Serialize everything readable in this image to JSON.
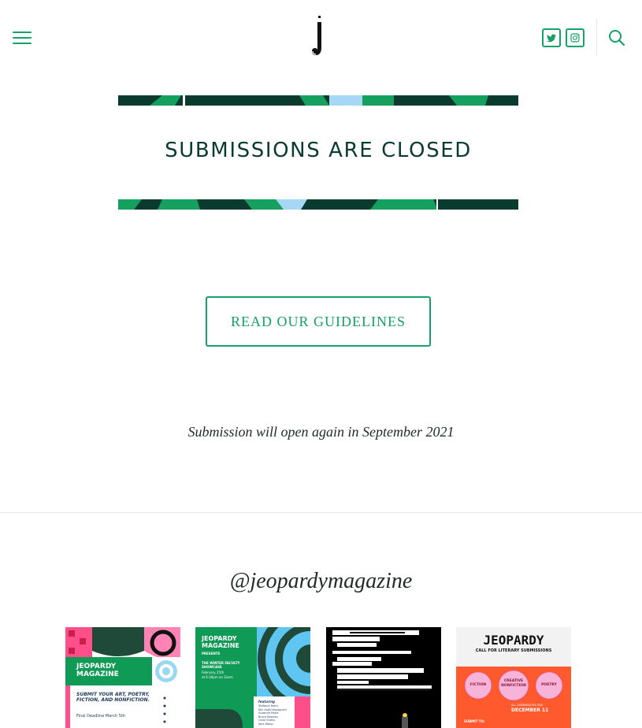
{
  "header": {
    "menu_icon": "hamburger-icon",
    "logo_icon": "jeopardy-j-logo",
    "social": [
      {
        "name": "twitter-icon"
      },
      {
        "name": "instagram-icon"
      }
    ],
    "search_icon": "search-icon"
  },
  "banner": {
    "title": "SUBMISSIONS ARE CLOSED",
    "colors": {
      "dark": "#0b3a2e",
      "green": "#15a05f",
      "blue": "#a6d8f5",
      "text": "#0b3a34"
    }
  },
  "guidelines_button": {
    "label": "READ OUR GUIDELINES"
  },
  "notice": "Submission will open again in September 2021",
  "instagram": {
    "handle": "@jeopardymagazine",
    "posts": [
      {
        "title": "JEOPARDY MAGAZINE",
        "body": "SUBMIT YOUR ART, POETRY, FICTION, AND NONFICTION.",
        "footer": "Final Deadline March 5th"
      },
      {
        "title": "JEOPARDY MAGAZINE",
        "subtitle": "PRESENTS",
        "event": "THE WINTER FACULTY SHOWCASE",
        "date": "February 25th",
        "time": "at 6:30pm on Zoom",
        "featuring_label": "featuring",
        "featuring": [
          "Stefania Heim",
          "Kiki Arabi Kavoguchi",
          "Suzanne Paola",
          "Bruce Beasley",
          "Carol Guess",
          "Jane Wong"
        ]
      },
      {
        "caption": "blackout poem"
      },
      {
        "title": "JEOPARDY",
        "subtitle": "CALL FOR LITERARY SUBMISSIONS",
        "badges": [
          "FICTION",
          "CREATIVE NONFICTION",
          "POETRY"
        ],
        "deadline_label": "ALL SUBMISSIONS DUE",
        "deadline": "DECEMBER 11",
        "footer": "SUBMIT TO:"
      }
    ]
  },
  "accent_color": "#16a06a"
}
